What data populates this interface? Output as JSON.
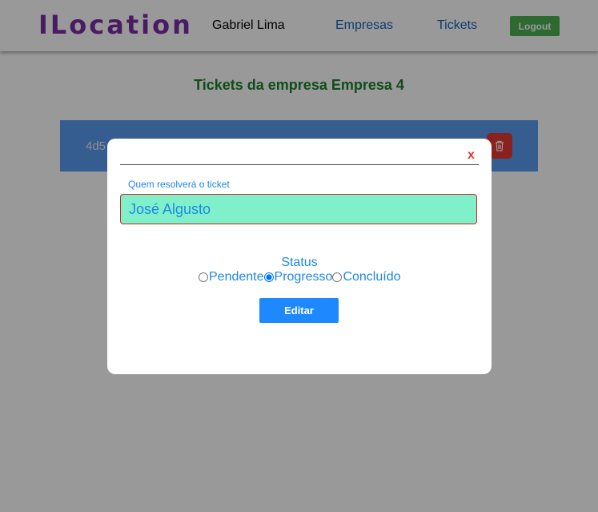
{
  "colors": {
    "brand": "#7b2ea6",
    "nav_link": "#1565c0",
    "logout_bg": "#4caf50",
    "title_green": "#1b7f2e",
    "card_bg": "#5b9bef",
    "trash_bg": "#e53935",
    "close_red": "#e53935",
    "accent_blue": "#1e88e5",
    "input_bg": "#7ff0c9",
    "input_border": "#c62828",
    "edit_bg": "#1e88ff"
  },
  "header": {
    "brand": "ILocation",
    "user_name": "Gabriel Lima",
    "nav_empresas": "Empresas",
    "nav_tickets": "Tickets",
    "logout_label": "Logout"
  },
  "page": {
    "title": "Tickets da empresa Empresa 4",
    "ticket_id_partial": "4d5",
    "trash_icon": "trash-icon"
  },
  "modal": {
    "close_label": "x",
    "resolver_label": "Quem resolverá o ticket",
    "resolver_value": "José Algusto",
    "status_label": "Status",
    "status_options": [
      "Pendente",
      "Progresso",
      "Concluído"
    ],
    "status_selected": "Progresso",
    "edit_label": "Editar"
  }
}
